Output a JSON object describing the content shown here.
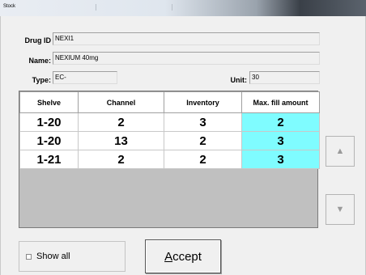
{
  "window": {
    "title": "Stock"
  },
  "form": {
    "drug_id_label": "Drug ID",
    "drug_id_value": "NEXI1",
    "name_label": "Name:",
    "name_value": "NEXIUM 40mg",
    "type_label": "Type:",
    "type_value": "EC-",
    "unit_label": "Unit:",
    "unit_value": "30"
  },
  "grid": {
    "columns": [
      "Shelve",
      "Channel",
      "Inventory",
      "Max. fill amount"
    ],
    "rows": [
      [
        "1-20",
        "2",
        "3",
        "2"
      ],
      [
        "1-20",
        "13",
        "2",
        "3"
      ],
      [
        "1-21",
        "2",
        "2",
        "3"
      ]
    ],
    "highlight_color": "#7ffcff"
  },
  "buttons": {
    "scroll_up_icon": "arrow-up-icon",
    "scroll_down_icon": "arrow-down-icon",
    "show_all_label": "Show all",
    "show_all_checked": false,
    "accept_label": "Accept",
    "accept_mnemonic": "A"
  }
}
